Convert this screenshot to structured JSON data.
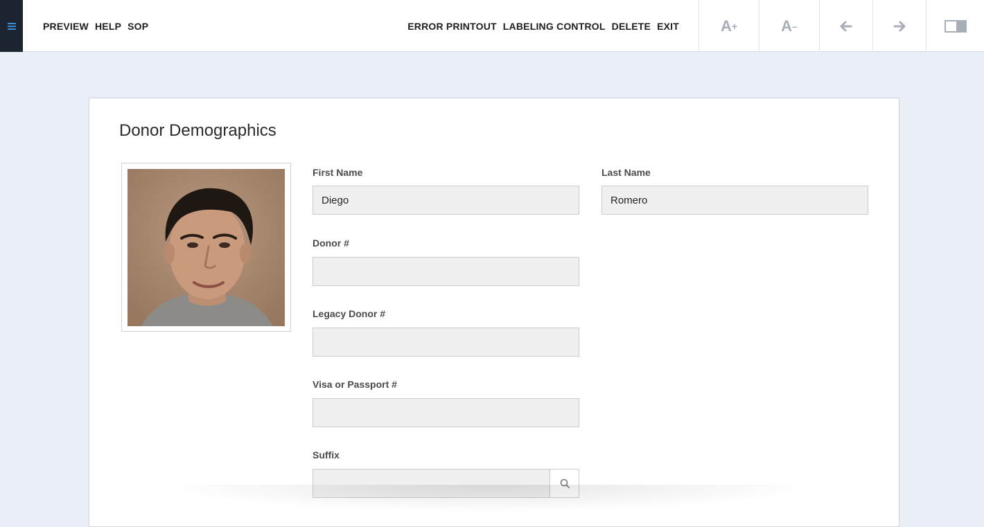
{
  "topbar": {
    "nav_left": [
      "PREVIEW",
      "HELP",
      "SOP"
    ],
    "nav_right": [
      "ERROR PRINTOUT",
      "LABELING CONTROL",
      "DELETE",
      "EXIT"
    ],
    "font_increase": "A",
    "font_increase_sign": "+",
    "font_decrease": "A",
    "font_decrease_sign": "–",
    "icons": [
      "menu-icon",
      "arrow-left-icon",
      "arrow-right-icon",
      "panel-toggle-icon"
    ]
  },
  "card": {
    "title": "Donor Demographics",
    "photo_icon": "donor-photo",
    "fields": {
      "first_name": {
        "label": "First Name",
        "value": "Diego"
      },
      "last_name": {
        "label": "Last Name",
        "value": "Romero"
      },
      "donor_number": {
        "label": "Donor #",
        "value": ""
      },
      "legacy_donor_number": {
        "label": "Legacy Donor #",
        "value": ""
      },
      "visa_passport": {
        "label": "Visa or Passport #",
        "value": ""
      },
      "suffix": {
        "label": "Suffix",
        "value": "",
        "icon": "search-icon"
      }
    }
  },
  "colors": {
    "accent": "#3b8ed6",
    "sidebar_dark": "#1b2430",
    "page_bg": "#eaeef6",
    "input_bg": "#f0f0f0"
  }
}
